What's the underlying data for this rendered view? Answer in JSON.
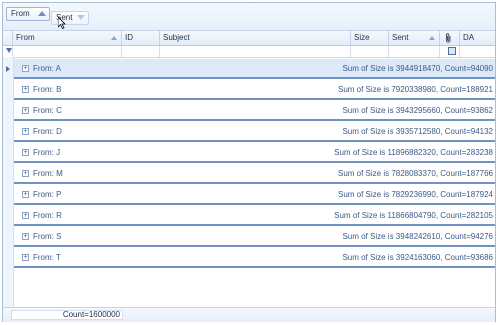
{
  "group_panel": {
    "chips": [
      {
        "label": "From"
      },
      {
        "label": "Sent"
      }
    ]
  },
  "columns": [
    {
      "label": "From"
    },
    {
      "label": "ID"
    },
    {
      "label": "Subject"
    },
    {
      "label": "Size"
    },
    {
      "label": "Sent"
    },
    {
      "label": "",
      "icon": "paperclip-icon"
    },
    {
      "label": "DA"
    }
  ],
  "groups": [
    {
      "label": "From: A",
      "summary": "Sum of Size is 3944918470,  Count=94090"
    },
    {
      "label": "From: B",
      "summary": "Sum of Size is 7920338980,  Count=188921"
    },
    {
      "label": "From: C",
      "summary": "Sum of Size is 3943295660,  Count=93862"
    },
    {
      "label": "From: D",
      "summary": "Sum of Size is 3935712580,  Count=94132"
    },
    {
      "label": "From: J",
      "summary": "Sum of Size is 11896882320,  Count=283238"
    },
    {
      "label": "From: M",
      "summary": "Sum of Size is 7828083370,  Count=187766"
    },
    {
      "label": "From: P",
      "summary": "Sum of Size is 7829236990,  Count=187924"
    },
    {
      "label": "From: R",
      "summary": "Sum of Size is 11866804790,  Count=282105"
    },
    {
      "label": "From: S",
      "summary": "Sum of Size is 3948242610,  Count=94276"
    },
    {
      "label": "From: T",
      "summary": "Sum of Size is 3924163060,  Count=93686"
    }
  ],
  "footer": {
    "count": "Count=1600000"
  }
}
